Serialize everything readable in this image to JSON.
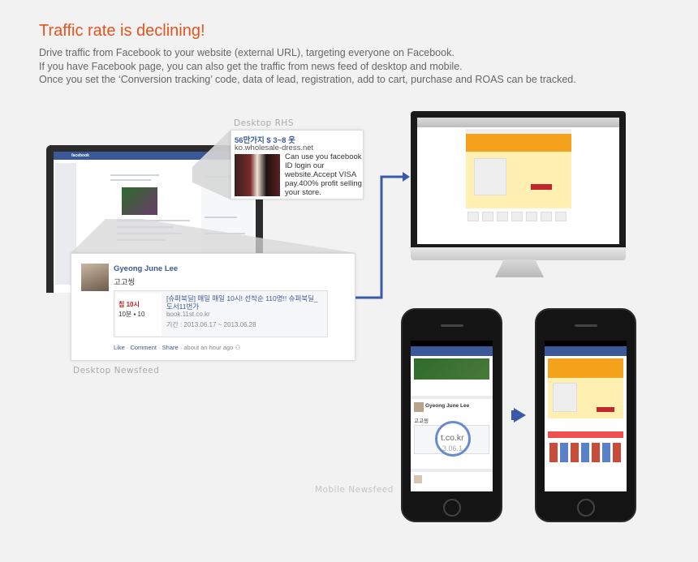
{
  "header": {
    "title": "Traffic rate is declining!",
    "lines": [
      "Drive traffic from Facebook to your website (external URL), targeting everyone on Facebook.",
      "If you have Facebook page, you can also get the traffic from news feed of desktop and mobile.",
      "Once you set the ‘Conversion tracking’ code, data of lead, registration, add to cart, purchase and ROAS can be tracked."
    ]
  },
  "captions": {
    "desktop_rhs": "Desktop RHS",
    "desktop_newsfeed": "Desktop Newsfeed",
    "mobile_newsfeed": "Mobile Newsfeed"
  },
  "desktop_screen": {
    "logo": "facebook"
  },
  "rhs_ad": {
    "title": "56만가지 $ 3~8 옷",
    "url": "ko.wholesale-dress.net",
    "text": "Can use you facebook ID login our website.Accept VISA pay.400% profit selling your store."
  },
  "newsfeed_post": {
    "author": "Gyeong June Lee",
    "message": "고고씽",
    "card_thumb_line1": "칩 10시",
    "card_thumb_line2": "10분 ▪ 10",
    "card_title": "[슈퍼북딜] 매일 매일 10시! 선착순 110명!! 슈퍼북딜_도서11번가",
    "card_url": "book.11st.co.kr",
    "card_period": "기간 : 2013.06.17 ~ 2013.06.28",
    "like": "Like",
    "comment": "Comment",
    "share": "Share",
    "time": "about an hour ago"
  },
  "mobile": {
    "post_author": "Gyeong June Lee",
    "post_message": "고고씽",
    "magnifier_text": "t.co.kr",
    "magnifier_subtext": "3.06.1"
  },
  "colors": {
    "title": "#e8531c",
    "facebook_blue": "#3b5998",
    "arrow_blue": "#3a5aa8"
  }
}
